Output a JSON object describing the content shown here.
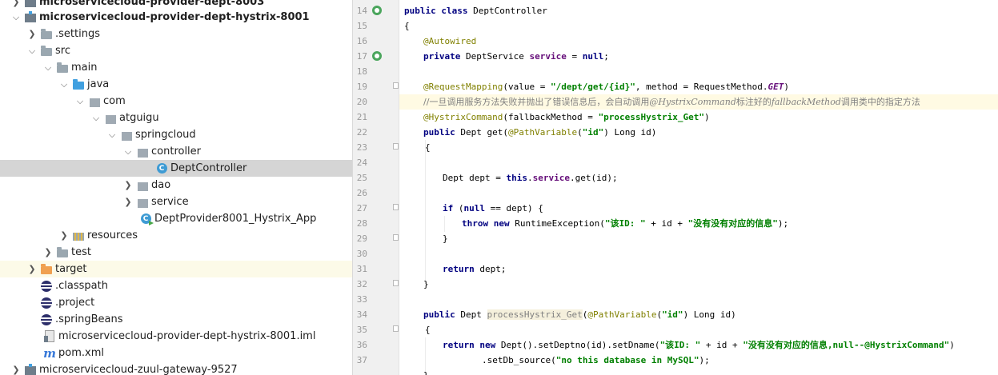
{
  "tree": {
    "items": [
      {
        "label": "microservicecloud-provider-dept-8003",
        "bold": true
      },
      {
        "label": "microservicecloud-provider-dept-hystrix-8001",
        "bold": true
      },
      {
        "label": ".settings"
      },
      {
        "label": "src"
      },
      {
        "label": "main"
      },
      {
        "label": "java"
      },
      {
        "label": "com"
      },
      {
        "label": "atguigu"
      },
      {
        "label": "springcloud"
      },
      {
        "label": "controller"
      },
      {
        "label": "DeptController"
      },
      {
        "label": "dao"
      },
      {
        "label": "service"
      },
      {
        "label": "DeptProvider8001_Hystrix_App"
      },
      {
        "label": "resources"
      },
      {
        "label": "test"
      },
      {
        "label": "target"
      },
      {
        "label": ".classpath"
      },
      {
        "label": ".project"
      },
      {
        "label": ".springBeans"
      },
      {
        "label": "microservicecloud-provider-dept-hystrix-8001.iml"
      },
      {
        "label": "pom.xml"
      },
      {
        "label": "microservicecloud-zuul-gateway-9527"
      }
    ],
    "class_icon_letter": "C",
    "maven_icon_letter": "m"
  },
  "editor": {
    "line_numbers": [
      "14",
      "15",
      "16",
      "17",
      "18",
      "19",
      "20",
      "21",
      "22",
      "23",
      "24",
      "25",
      "26",
      "27",
      "28",
      "29",
      "30",
      "31",
      "32",
      "33",
      "34",
      "35",
      "36",
      "37"
    ],
    "code": {
      "l14_kw1": "public",
      "l14_kw2": "class",
      "l14_name": "DeptController",
      "l15": "{",
      "l16": "@Autowired",
      "l17_kw": "private",
      "l17_type": "DeptService",
      "l17_field": "service",
      "l17_eq": "=",
      "l17_null": "null",
      "l17_end": ";",
      "l19_ann": "@RequestMapping",
      "l19_a": "(value = ",
      "l19_str": "\"/dept/get/{id}\"",
      "l19_b": ", method = RequestMethod.",
      "l19_const": "GET",
      "l19_c": ")",
      "l20_a": "//一旦调用服务方法失败并抛出了错误信息后，会自动调用",
      "l20_i1": "@HystrixCommand",
      "l20_b": "标注好的",
      "l20_i2": "fallbackMethod",
      "l20_c": "调用类中的指定方法",
      "l21_ann": "@HystrixCommand",
      "l21_a": "(fallbackMethod = ",
      "l21_str": "\"processHystrix_Get\"",
      "l21_c": ")",
      "l22_kw": "public",
      "l22_a": "Dept get(",
      "l22_ann": "@PathVariable",
      "l22_b": "(",
      "l22_str": "\"id\"",
      "l22_c": ") Long id)",
      "l23": "{",
      "l25_a": "Dept dept = ",
      "l25_kw": "this",
      "l25_b": ".",
      "l25_field": "service",
      "l25_c": ".get(id);",
      "l27_kw": "if",
      "l27_a": " (",
      "l27_null": "null",
      "l27_b": " == dept) {",
      "l28_kw1": "throw",
      "l28_kw2": "new",
      "l28_a": "RuntimeException(",
      "l28_s1": "\"该ID: \"",
      "l28_b": " + id + ",
      "l28_s2": "\"没有没有对应的信息\"",
      "l28_c": ");",
      "l29": "}",
      "l31_kw": "return",
      "l31_a": " dept;",
      "l32": "}",
      "l34_kw": "public",
      "l34_a": "Dept ",
      "l34_m": "processHystrix_Get",
      "l34_b": "(",
      "l34_ann": "@PathVariable",
      "l34_c": "(",
      "l34_str": "\"id\"",
      "l34_d": ") Long id)",
      "l35": "{",
      "l36_kw1": "return",
      "l36_kw2": "new",
      "l36_a": "Dept().setDeptno(id).setDname(",
      "l36_s1": "\"该ID: \"",
      "l36_b": " + id + ",
      "l36_s2": "\"没有没有对应的信息,null--@HystrixCommand\"",
      "l36_c": ")",
      "l37_a": ".setDb_source(",
      "l37_str": "\"no this database in MySQL\"",
      "l37_b": ");",
      "l38": "}"
    }
  }
}
